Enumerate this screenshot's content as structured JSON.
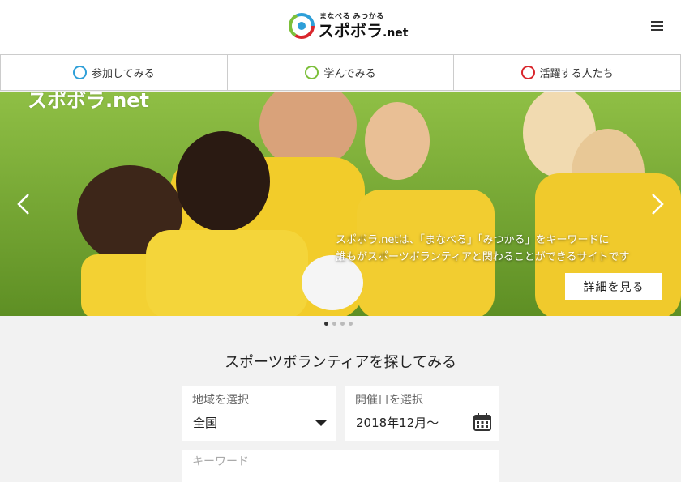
{
  "header": {
    "logo_sub": "まなべる みつかる",
    "logo_main": "スポボラ",
    "logo_suffix": ".net",
    "menu_icon": "hamburger-icon"
  },
  "nav": {
    "items": [
      {
        "label": "参加してみる",
        "icon": "participate-icon",
        "color": "#2e9fd8"
      },
      {
        "label": "学んでみる",
        "icon": "learn-icon",
        "color": "#7cbf3a"
      },
      {
        "label": "活躍する人たち",
        "icon": "people-icon",
        "color": "#d9262c"
      }
    ]
  },
  "hero": {
    "slide_logo": "スポボラ.net",
    "caption_line1": "スポボラ.netは、「まなべる」「みつかる」をキーワードに",
    "caption_line2": "誰もがスポーツボランティアと関わることができるサイトです",
    "detail_button": "詳細を見る",
    "slides": 4,
    "active_slide": 1
  },
  "search": {
    "title": "スポーツボランティアを探してみる",
    "area_label": "地域を選択",
    "area_value": "全国",
    "date_label": "開催日を選択",
    "date_value": "2018年12月～",
    "keyword_placeholder": "キーワード"
  }
}
